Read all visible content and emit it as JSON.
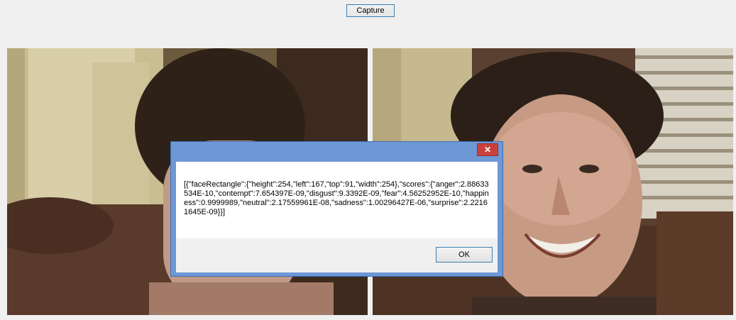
{
  "toolbar": {
    "capture_label": "Capture"
  },
  "dialog": {
    "message": "[{\"faceRectangle\":{\"height\":254,\"left\":167,\"top\":91,\"width\":254},\"scores\":{\"anger\":2.88633534E-10,\"contempt\":7.654397E-09,\"disgust\":9.3392E-09,\"fear\":4.56252952E-10,\"happiness\":0.9999989,\"neutral\":2.17559961E-08,\"sadness\":1.00296427E-06,\"surprise\":2.22161645E-09}}]",
    "close_glyph": "✕",
    "ok_label": "OK"
  },
  "colors": {
    "window_bg": "#f0f0f0",
    "dialog_frame": "#6e97d6",
    "close_button": "#c7413a"
  }
}
